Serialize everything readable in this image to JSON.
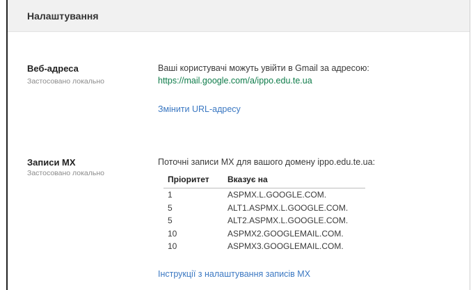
{
  "header": {
    "title": "Налаштування"
  },
  "web_address": {
    "title": "Веб-адреса",
    "subtitle": "Застосовано локально",
    "description": "Ваші користувачі можуть увійти в Gmail за адресою:",
    "url": "https://mail.google.com/a/ippo.edu.te.ua",
    "change_link": "Змінити URL-адресу"
  },
  "mx_records": {
    "title": "Записи MX",
    "subtitle": "Застосовано локально",
    "description": "Поточні записи MX для вашого домену ippo.edu.te.ua:",
    "columns": [
      "Пріоритет",
      "Вказує на"
    ],
    "rows": [
      [
        "1",
        "ASPMX.L.GOOGLE.COM."
      ],
      [
        "5",
        "ALT1.ASPMX.L.GOOGLE.COM."
      ],
      [
        "5",
        "ALT2.ASPMX.L.GOOGLE.COM."
      ],
      [
        "10",
        "ASPMX2.GOOGLEMAIL.COM."
      ],
      [
        "10",
        "ASPMX3.GOOGLEMAIL.COM."
      ]
    ],
    "instructions_link": "Інструкції з налаштування записів MX"
  }
}
